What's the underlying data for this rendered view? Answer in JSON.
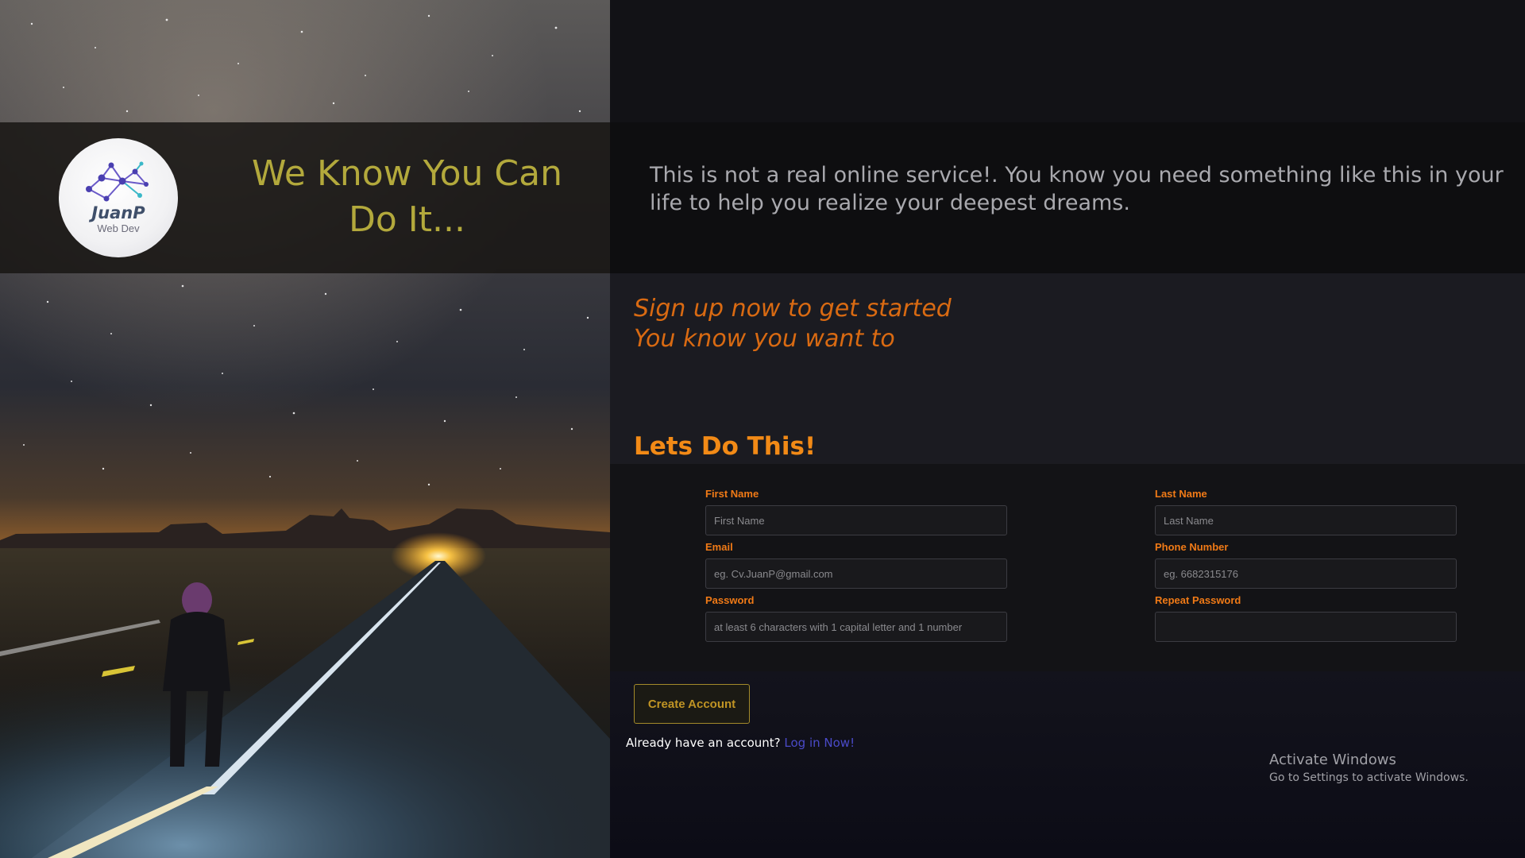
{
  "logo": {
    "name": "JuanP",
    "subtitle": "Web Dev"
  },
  "banner": {
    "title": "We Know You Can Do It...",
    "description": "This is not a real online service!. You know you need something like this in your life to help you realize your deepest dreams."
  },
  "intro": {
    "tagline_line1": "Sign up now to get started",
    "tagline_line2": "You know you want to",
    "heading": "Lets Do This!"
  },
  "form": {
    "first_name": {
      "label": "First Name",
      "placeholder": "First Name",
      "value": ""
    },
    "last_name": {
      "label": "Last Name",
      "placeholder": "Last Name",
      "value": ""
    },
    "email": {
      "label": "Email",
      "placeholder": "eg. Cv.JuanP@gmail.com",
      "value": ""
    },
    "phone": {
      "label": "Phone Number",
      "placeholder": "eg. 6682315176",
      "value": ""
    },
    "password": {
      "label": "Password",
      "placeholder": "at least 6 characters with 1 capital letter and 1 number",
      "value": ""
    },
    "repeat_password": {
      "label": "Repeat Password",
      "placeholder": "",
      "value": ""
    },
    "submit_label": "Create Account"
  },
  "footer": {
    "already_text": "Already have an account?",
    "login_link": "Log in Now!"
  },
  "watermark": {
    "title": "Activate Windows",
    "subtitle": "Go to Settings to activate Windows."
  },
  "colors": {
    "accent_orange": "#f28a16",
    "title_gold": "#b3a93c",
    "link_blue": "#4a4ac8"
  },
  "icons": [
    "network-logo-icon"
  ]
}
